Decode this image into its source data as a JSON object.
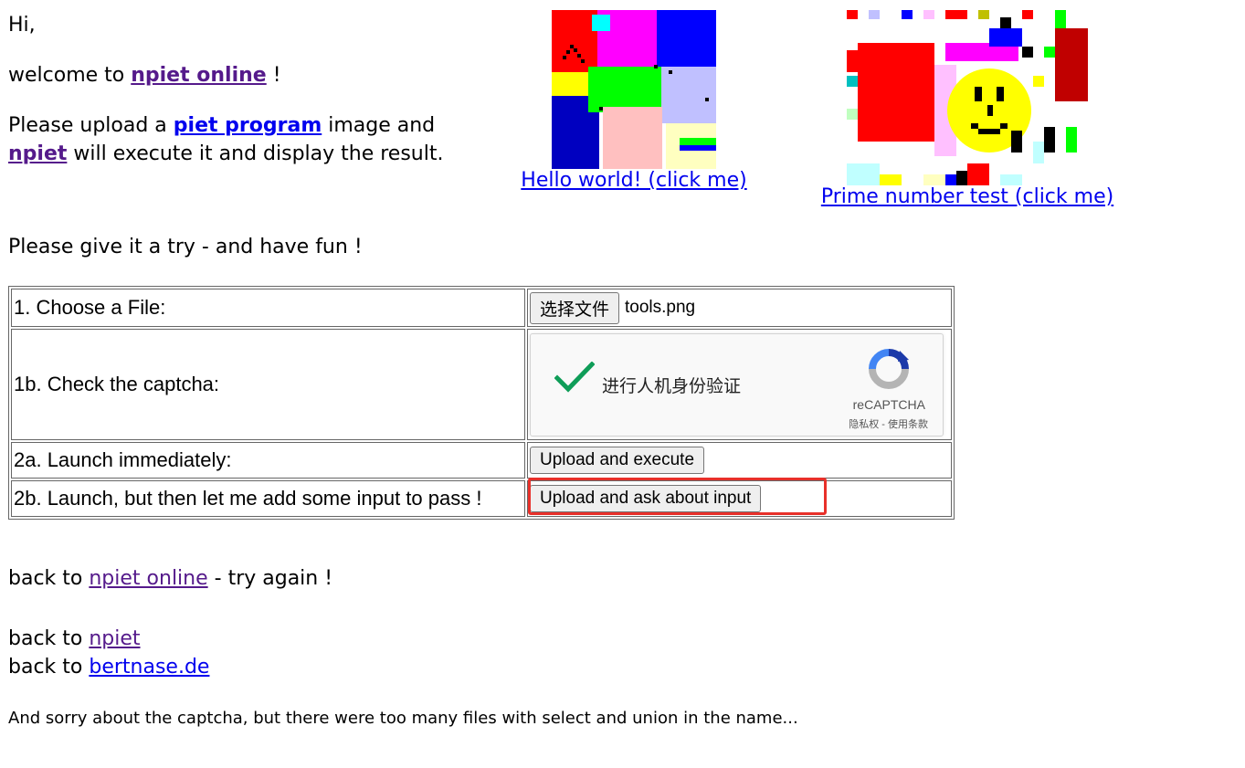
{
  "intro": {
    "hi": "Hi,",
    "welcome_prefix": "welcome to ",
    "welcome_link": "npiet online",
    "welcome_suffix": " !",
    "upload_prefix": "Please upload a ",
    "upload_link": "piet program",
    "upload_middle": " image and",
    "npiet_link": "npiet",
    "upload_suffix": " will execute it and display the result."
  },
  "samples": [
    {
      "label": "Hello world! (click me)"
    },
    {
      "label": "Prime number test (click me)"
    }
  ],
  "try_text": "Please give it a try - and have fun !",
  "form": {
    "row1_label": "1. Choose a File:",
    "choose_button": "选择文件",
    "file_name": "tools.png",
    "row1b_label": "1b. Check the captcha:",
    "captcha_text": "进行人机身份验证",
    "captcha_brand": "reCAPTCHA",
    "captcha_terms": "隐私权 - 使用条款",
    "row2a_label": "2a. Launch immediately:",
    "execute_button": "Upload and execute",
    "row2b_label": "2b. Launch, but then let me add some input to pass !",
    "input_button": "Upload and ask about input"
  },
  "footer": {
    "back_prefix": "back to ",
    "online_link": "npiet online",
    "try_again": " - try again !",
    "npiet_link": "npiet",
    "bertnase_link": "bertnase.de",
    "sorry": "And sorry about the captcha, but there were too many files with select and union in the name..."
  },
  "colors": {
    "link": "#0000ee",
    "visited_link": "#551a8b",
    "highlight": "#e8302a",
    "captcha_check": "#0f9d58"
  }
}
